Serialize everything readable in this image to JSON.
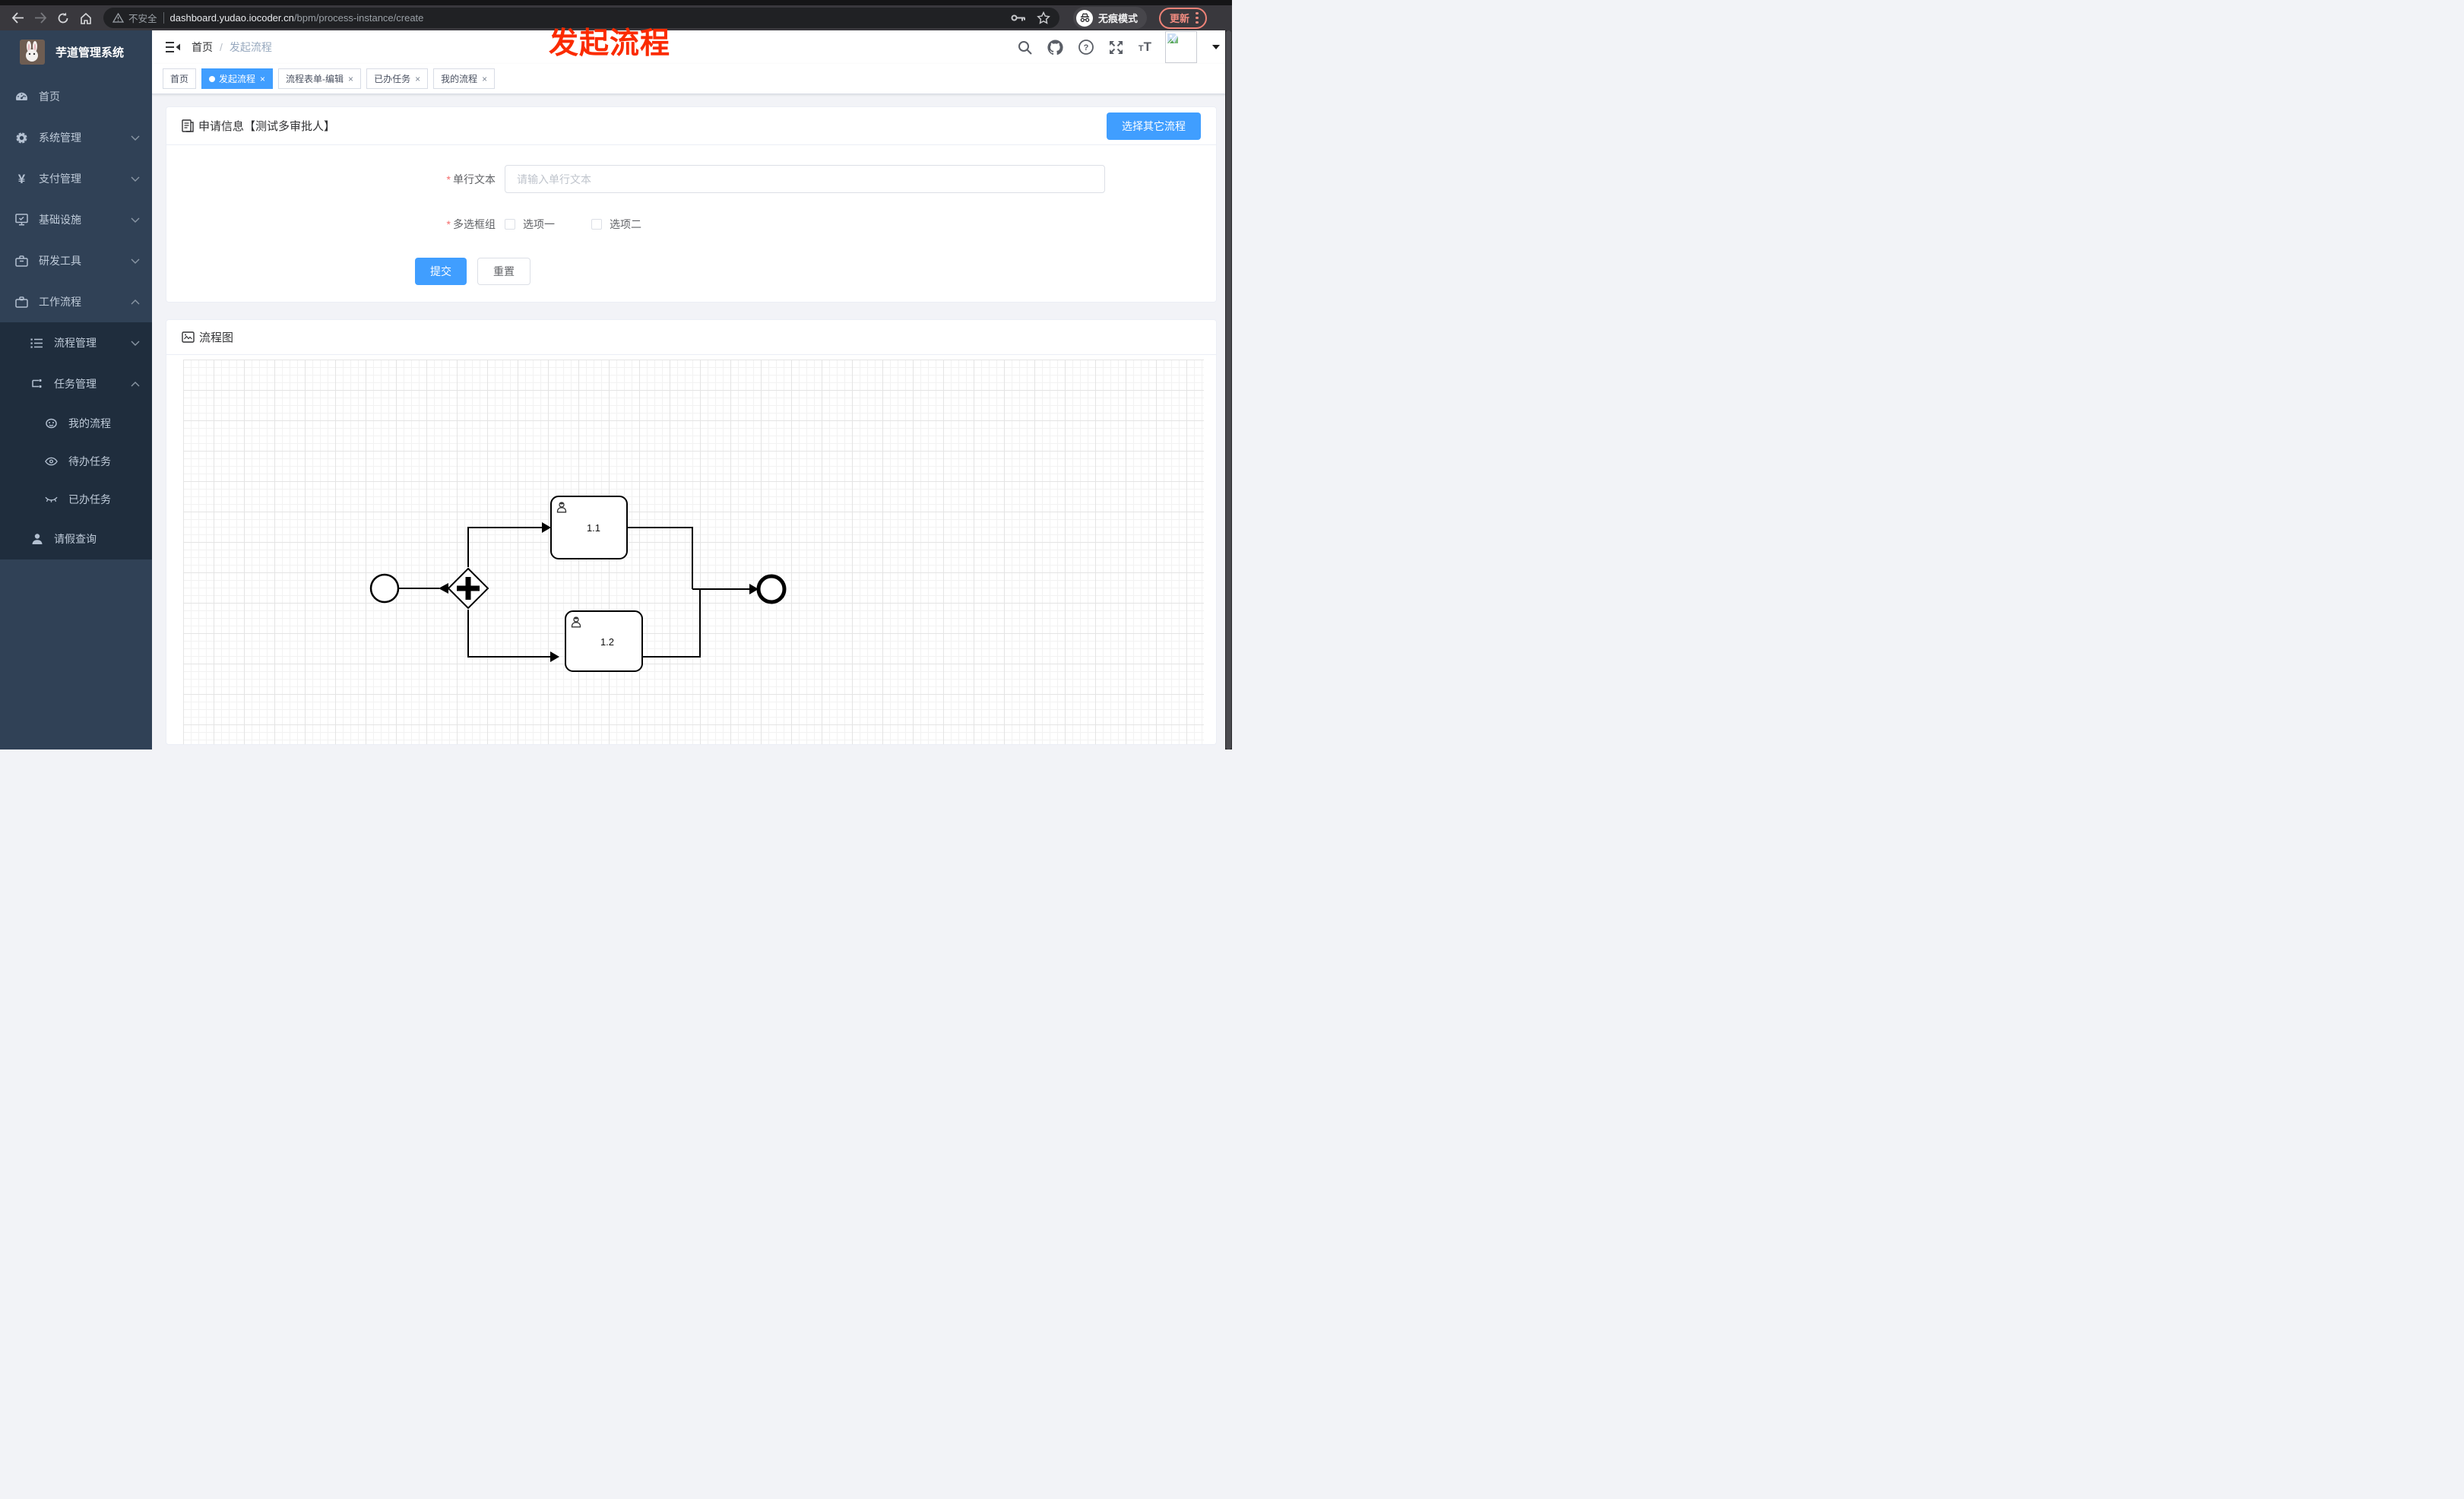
{
  "browser": {
    "security_label": "不安全",
    "url_domain": "dashboard.yudao.iocoder.cn",
    "url_path": "/bpm/process-instance/create",
    "incognito_label": "无痕模式",
    "update_label": "更新"
  },
  "annotation": {
    "text": "发起流程",
    "color": "#fb2b00"
  },
  "sidebar": {
    "title": "芋道管理系统",
    "items": [
      {
        "label": "首页",
        "icon": "dashboard-icon",
        "chevron": "none"
      },
      {
        "label": "系统管理",
        "icon": "gear-icon",
        "chevron": "down"
      },
      {
        "label": "支付管理",
        "icon": "yen-icon",
        "chevron": "down"
      },
      {
        "label": "基础设施",
        "icon": "monitor-icon",
        "chevron": "down"
      },
      {
        "label": "研发工具",
        "icon": "toolbox-icon",
        "chevron": "down"
      },
      {
        "label": "工作流程",
        "icon": "briefcase-icon",
        "chevron": "up"
      }
    ],
    "submenu": [
      {
        "label": "流程管理",
        "icon": "list-icon",
        "chevron": "down"
      },
      {
        "label": "任务管理",
        "icon": "flow-icon",
        "chevron": "up"
      },
      {
        "label": "我的流程",
        "icon": "face-icon"
      },
      {
        "label": "待办任务",
        "icon": "eye-icon"
      },
      {
        "label": "已办任务",
        "icon": "eye-closed-icon"
      },
      {
        "label": "请假查询",
        "icon": "user-icon"
      }
    ]
  },
  "header": {
    "breadcrumb": [
      "首页",
      "发起流程"
    ],
    "separator": "/"
  },
  "tabs": [
    {
      "label": "首页",
      "active": false,
      "closable": false
    },
    {
      "label": "发起流程",
      "active": true,
      "closable": true
    },
    {
      "label": "流程表单-编辑",
      "active": false,
      "closable": true
    },
    {
      "label": "已办任务",
      "active": false,
      "closable": true
    },
    {
      "label": "我的流程",
      "active": false,
      "closable": true
    }
  ],
  "ui": {
    "close_glyph": "×",
    "required_glyph": "*",
    "accent": "#409eff",
    "sidebar_bg": "#304156",
    "submenu_bg": "#1f2d3d"
  },
  "form_card": {
    "title": "申请信息【测试多审批人】",
    "action_button": "选择其它流程",
    "fields": {
      "text": {
        "label": "单行文本",
        "required": true,
        "placeholder": "请输入单行文本",
        "value": ""
      },
      "checkbox_group": {
        "label": "多选框组",
        "required": true,
        "options": [
          {
            "label": "选项一",
            "checked": false
          },
          {
            "label": "选项二",
            "checked": false
          }
        ]
      }
    },
    "submit_label": "提交",
    "reset_label": "重置"
  },
  "diagram_card": {
    "title": "流程图",
    "bpmn": {
      "type": "bpmn-process",
      "nodes": [
        "start-event",
        "parallel-gateway",
        "user-task-1.1",
        "user-task-1.2",
        "end-event"
      ],
      "task_labels": [
        "1.1",
        "1.2"
      ]
    }
  }
}
